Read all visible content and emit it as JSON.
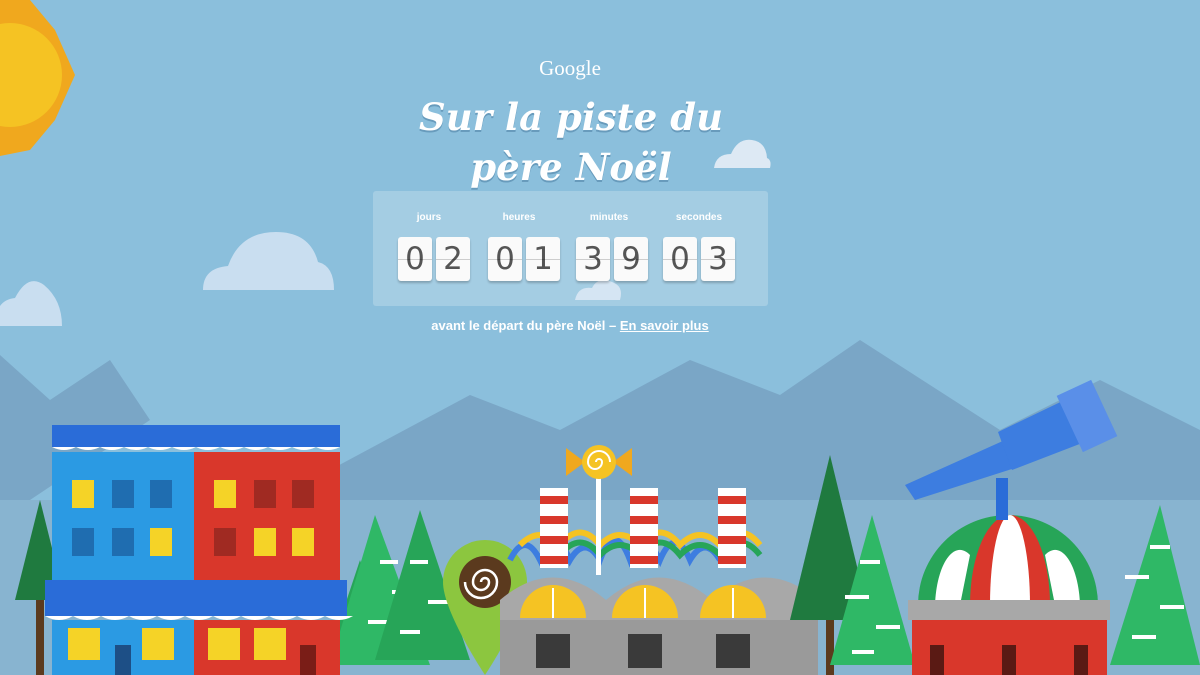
{
  "header": {
    "brand": "Google",
    "title_line1": "Sur la piste du",
    "title_line2": "père Noël"
  },
  "countdown": {
    "units": [
      {
        "label": "jours",
        "digits": [
          "0",
          "2"
        ]
      },
      {
        "label": "heures",
        "digits": [
          "0",
          "1"
        ]
      },
      {
        "label": "minutes",
        "digits": [
          "3",
          "9"
        ]
      },
      {
        "label": "secondes",
        "digits": [
          "0",
          "3"
        ]
      }
    ]
  },
  "footer": {
    "before_text": "avant le départ du père Noël –",
    "learn_more": "En savoir plus"
  },
  "colors": {
    "sky": "#8bbfdc",
    "sun": "#f5c323",
    "building_blue": "#2b9ae3",
    "building_red": "#d9372b",
    "window_yellow": "#f5d327",
    "tree_green": "#27a558",
    "pin_green": "#8cc63f",
    "telescope_blue": "#3d7de0",
    "dome_green": "#27a558",
    "dome_red": "#d9372b"
  },
  "icons": {
    "sun": "sun-icon",
    "cloud": "cloud-icon",
    "map_pin": "map-pin-icon",
    "candy": "candy-icon",
    "telescope": "telescope-icon"
  }
}
